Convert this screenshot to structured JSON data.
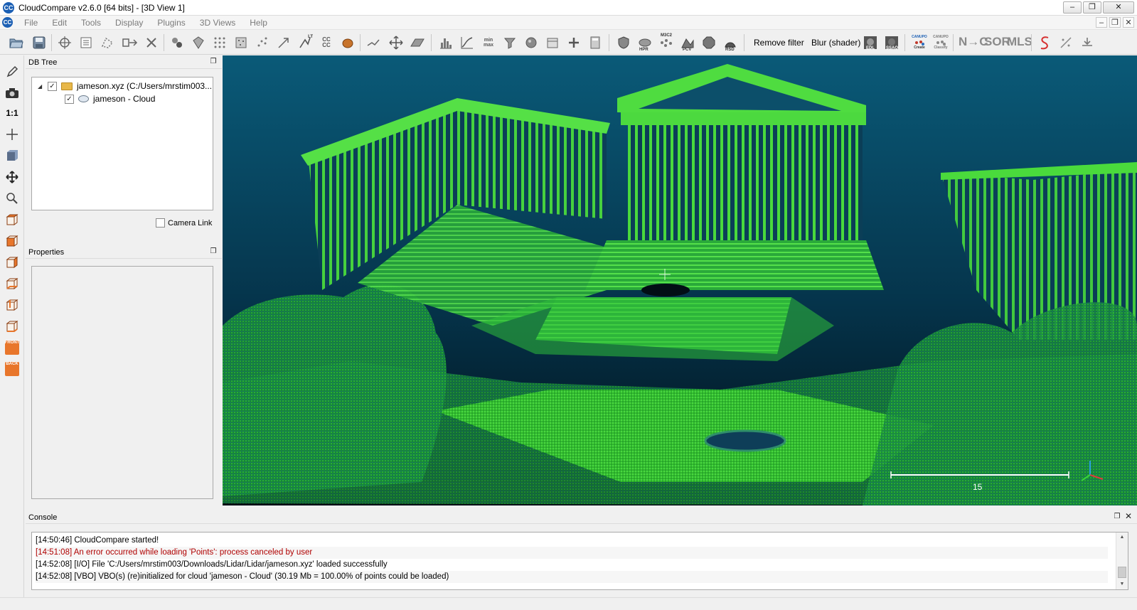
{
  "window": {
    "title": "CloudCompare v2.6.0 [64 bits] - [3D View 1]",
    "app_icon": "CC",
    "controls": [
      "–",
      "❐",
      "✕"
    ]
  },
  "menubar": {
    "items": [
      "File",
      "Edit",
      "Tools",
      "Display",
      "Plugins",
      "3D Views",
      "Help"
    ],
    "mdi_controls": [
      "–",
      "❐",
      "✕"
    ]
  },
  "toolbar": {
    "icon_labels": {
      "lt": "LT",
      "min_max": "min\nmax",
      "cc": "CC\nCC",
      "hpr": "HPR",
      "m3c2": "M3C2",
      "pcv": "PCV",
      "rsd": "RSD",
      "edl": "EDL",
      "ssao": "SSAO",
      "canupo_create": "Create",
      "canupo_classify": "Classify",
      "canupo": "CANUPO"
    },
    "remove_filter": "Remove filter",
    "blur_shader": "Blur (shader)",
    "n_c": "N→C",
    "sor": "SOR",
    "mls": "MLS"
  },
  "lefttoolbar": {
    "one_to_one": "1:1",
    "front": "FRONT",
    "back": "BACK"
  },
  "dbtree": {
    "title": "DB Tree",
    "items": [
      {
        "label": "jameson.xyz (C:/Users/mrstim003...",
        "checked": true,
        "type": "folder"
      },
      {
        "label": "jameson - Cloud",
        "checked": true,
        "type": "cloud"
      }
    ],
    "camera_link": "Camera Link"
  },
  "properties": {
    "title": "Properties"
  },
  "view3d": {
    "scale_label": "15"
  },
  "console": {
    "title": "Console",
    "lines": [
      {
        "text": "[14:50:46] CloudCompare started!",
        "error": false
      },
      {
        "text": "[14:51:08] An error occurred while loading 'Points': process canceled by user",
        "error": true
      },
      {
        "text": "[14:52:08] [I/O] File 'C:/Users/mrstim003/Downloads/Lidar/Lidar/jameson.xyz' loaded successfully",
        "error": false
      },
      {
        "text": "[14:52:08] [VBO] VBO(s) (re)initialized for cloud 'jameson - Cloud' (30.19 Mb = 100.00% of points could be loaded)",
        "error": false
      }
    ]
  },
  "colors": {
    "cloud_green": "#3dd62f",
    "cloud_blue": "#1f6fb0",
    "background_top": "#0a5a78",
    "background_bottom": "#020d15",
    "error_text": "#b00000"
  }
}
